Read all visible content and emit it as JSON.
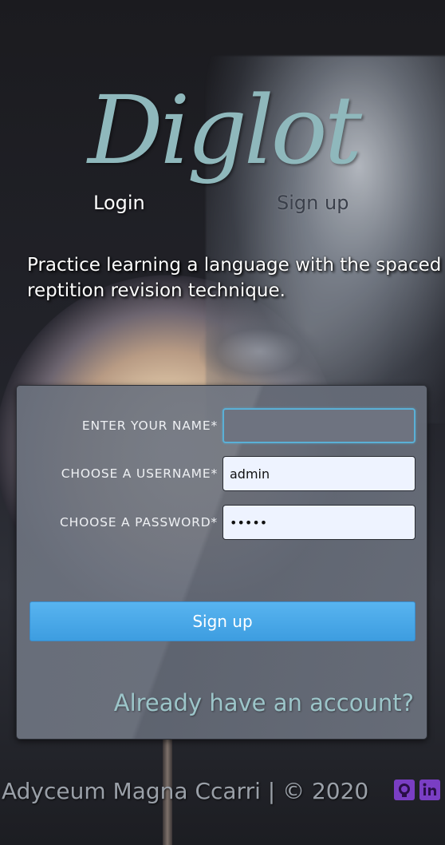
{
  "logo": {
    "text": "Diglot"
  },
  "nav": {
    "login": "Login",
    "signup": "Sign up"
  },
  "tagline": "Practice learning a language with the spaced reptition revision technique.",
  "form": {
    "name_label": "ENTER YOUR NAME*",
    "name_value": "",
    "username_label": "CHOOSE A USERNAME*",
    "username_value": "admin",
    "password_label": "CHOOSE A PASSWORD*",
    "password_value": "admin",
    "submit_label": "Sign up",
    "already_link": "Already have an account?"
  },
  "footer": {
    "text": "Adyceum Magna Ccarri | © 2020",
    "github_icon": "github-icon",
    "linkedin_icon": "linkedin-icon"
  },
  "colors": {
    "logo": "#8fb8bc",
    "button": "#48a8ea",
    "social_icons": "#7a3ec4"
  }
}
